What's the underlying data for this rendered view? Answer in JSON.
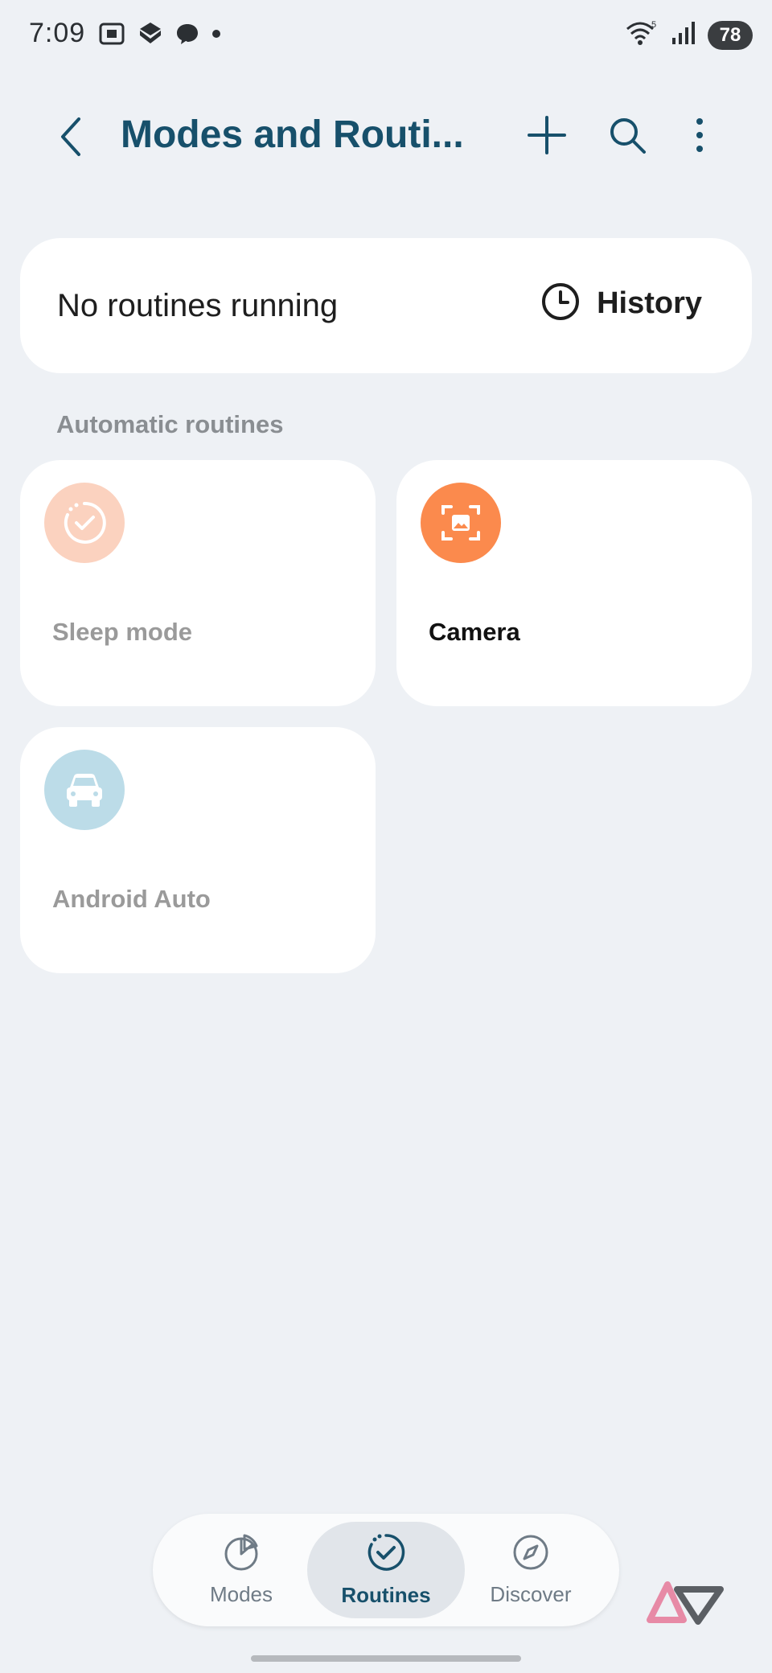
{
  "status_bar": {
    "time": "7:09",
    "battery": "78",
    "icons_left": [
      "screenshot-icon",
      "layers-icon",
      "chat-bubble-icon",
      "dot-icon"
    ],
    "icons_right": [
      "wifi-icon",
      "signal-icon",
      "battery-icon"
    ]
  },
  "header": {
    "title": "Modes and Routi...",
    "back_icon": "chevron-left-icon",
    "actions": [
      "add-icon",
      "search-icon",
      "more-vert-icon"
    ]
  },
  "status_card": {
    "text": "No routines running",
    "history_label": "History",
    "history_icon": "clock-icon"
  },
  "section": {
    "label": "Automatic routines"
  },
  "routines": [
    {
      "label": "Sleep mode",
      "icon": "routine-check-icon",
      "color": "#fbd2bf",
      "label_color": "#9a9a9a"
    },
    {
      "label": "Camera",
      "icon": "camera-frame-icon",
      "color": "#fb8a4d",
      "label_color": "#111111"
    },
    {
      "label": "Android Auto",
      "icon": "car-icon",
      "color": "#bcdce8",
      "label_color": "#9a9a9a"
    }
  ],
  "bottom_nav": {
    "items": [
      {
        "label": "Modes",
        "icon": "pie-chart-icon",
        "active": false
      },
      {
        "label": "Routines",
        "icon": "routine-check-icon",
        "active": true
      },
      {
        "label": "Discover",
        "icon": "compass-icon",
        "active": false
      }
    ]
  },
  "colors": {
    "background": "#eef1f5",
    "accent": "#17506b",
    "card": "#ffffff"
  }
}
